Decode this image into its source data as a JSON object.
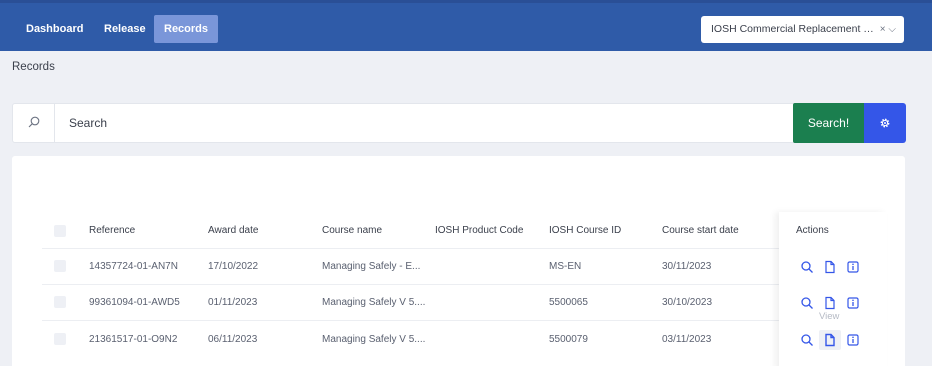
{
  "nav": {
    "items": [
      {
        "label": "Dashboard"
      },
      {
        "label": "Release"
      },
      {
        "label": "Records"
      }
    ],
    "course_select": {
      "value": "IOSH Commercial Replacement Certi...",
      "clear": "×",
      "chevron": "⌵"
    }
  },
  "breadcrumb": "Records",
  "search": {
    "placeholder": "Search",
    "button_label": "Search!",
    "icon": "search-icon",
    "settings_icon": "gear-icon"
  },
  "table": {
    "headers": [
      "Reference",
      "Award date",
      "Course name",
      "IOSH Product Code",
      "IOSH Course ID",
      "Course start date",
      "Actions"
    ],
    "rows": [
      {
        "reference": "14357724-01-AN7N",
        "award_date": "17/10/2022",
        "course_name": "Managing Safely - E...",
        "product_code": "",
        "course_id": "MS-EN",
        "start_date": "30/11/2023"
      },
      {
        "reference": "99361094-01-AWD5",
        "award_date": "01/11/2023",
        "course_name": "Managing Safely V 5....",
        "product_code": "",
        "course_id": "5500065",
        "start_date": "30/10/2023"
      },
      {
        "reference": "21361517-01-O9N2",
        "award_date": "06/11/2023",
        "course_name": "Managing Safely V 5....",
        "product_code": "",
        "course_id": "5500079",
        "start_date": "03/11/2023"
      }
    ],
    "action_icons": [
      "magnifier-icon",
      "document-icon",
      "info-icon"
    ],
    "tooltip": "View"
  },
  "colors": {
    "topbar": "#2f5ba8",
    "nav_active": "#7a96d9",
    "search_button": "#1b7f4f",
    "settings_button": "#3456e8",
    "action_icon": "#3456e8"
  }
}
